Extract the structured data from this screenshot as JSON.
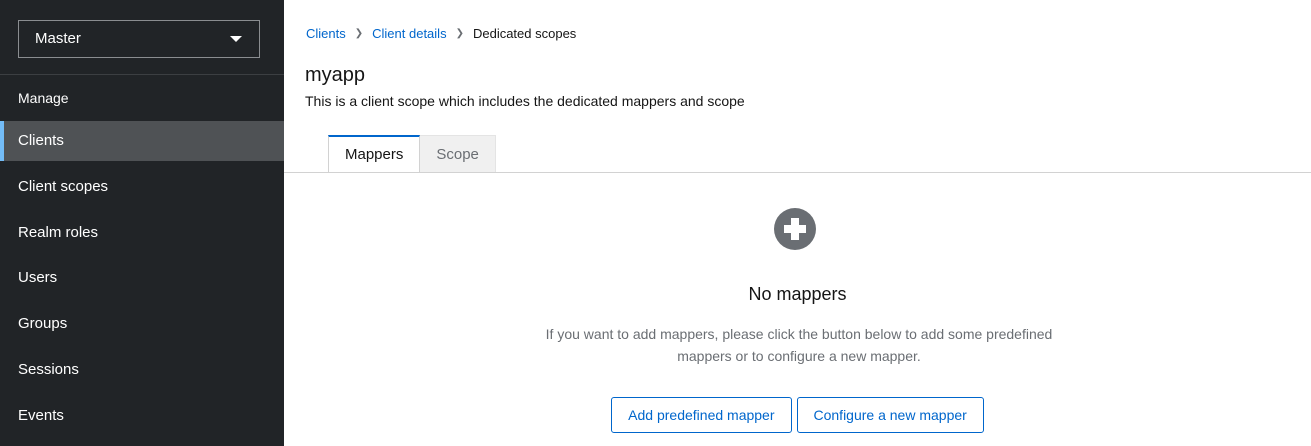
{
  "sidebar": {
    "realm": "Master",
    "section_label": "Manage",
    "items": [
      {
        "label": "Clients",
        "active": true
      },
      {
        "label": "Client scopes"
      },
      {
        "label": "Realm roles"
      },
      {
        "label": "Users"
      },
      {
        "label": "Groups"
      },
      {
        "label": "Sessions"
      },
      {
        "label": "Events"
      }
    ]
  },
  "breadcrumb": {
    "items": [
      "Clients",
      "Client details"
    ],
    "current": "Dedicated scopes",
    "separator": "❯"
  },
  "header": {
    "title": "myapp",
    "description": "This is a client scope which includes the dedicated mappers and scope"
  },
  "tabs": [
    {
      "label": "Mappers",
      "active": true
    },
    {
      "label": "Scope"
    }
  ],
  "empty_state": {
    "icon": "plus-circle-icon",
    "title": "No mappers",
    "body_line1": "If you want to add mappers, please click the button below to add some predefined",
    "body_line2": "mappers or to configure a new mapper.",
    "buttons": {
      "add_predefined": "Add predefined mapper",
      "configure_new": "Configure a new mapper"
    }
  },
  "colors": {
    "sidebar_bg": "#212427",
    "active_item_bg": "#4f5255",
    "accent": "#0066cc",
    "active_indicator": "#73bcf7"
  }
}
